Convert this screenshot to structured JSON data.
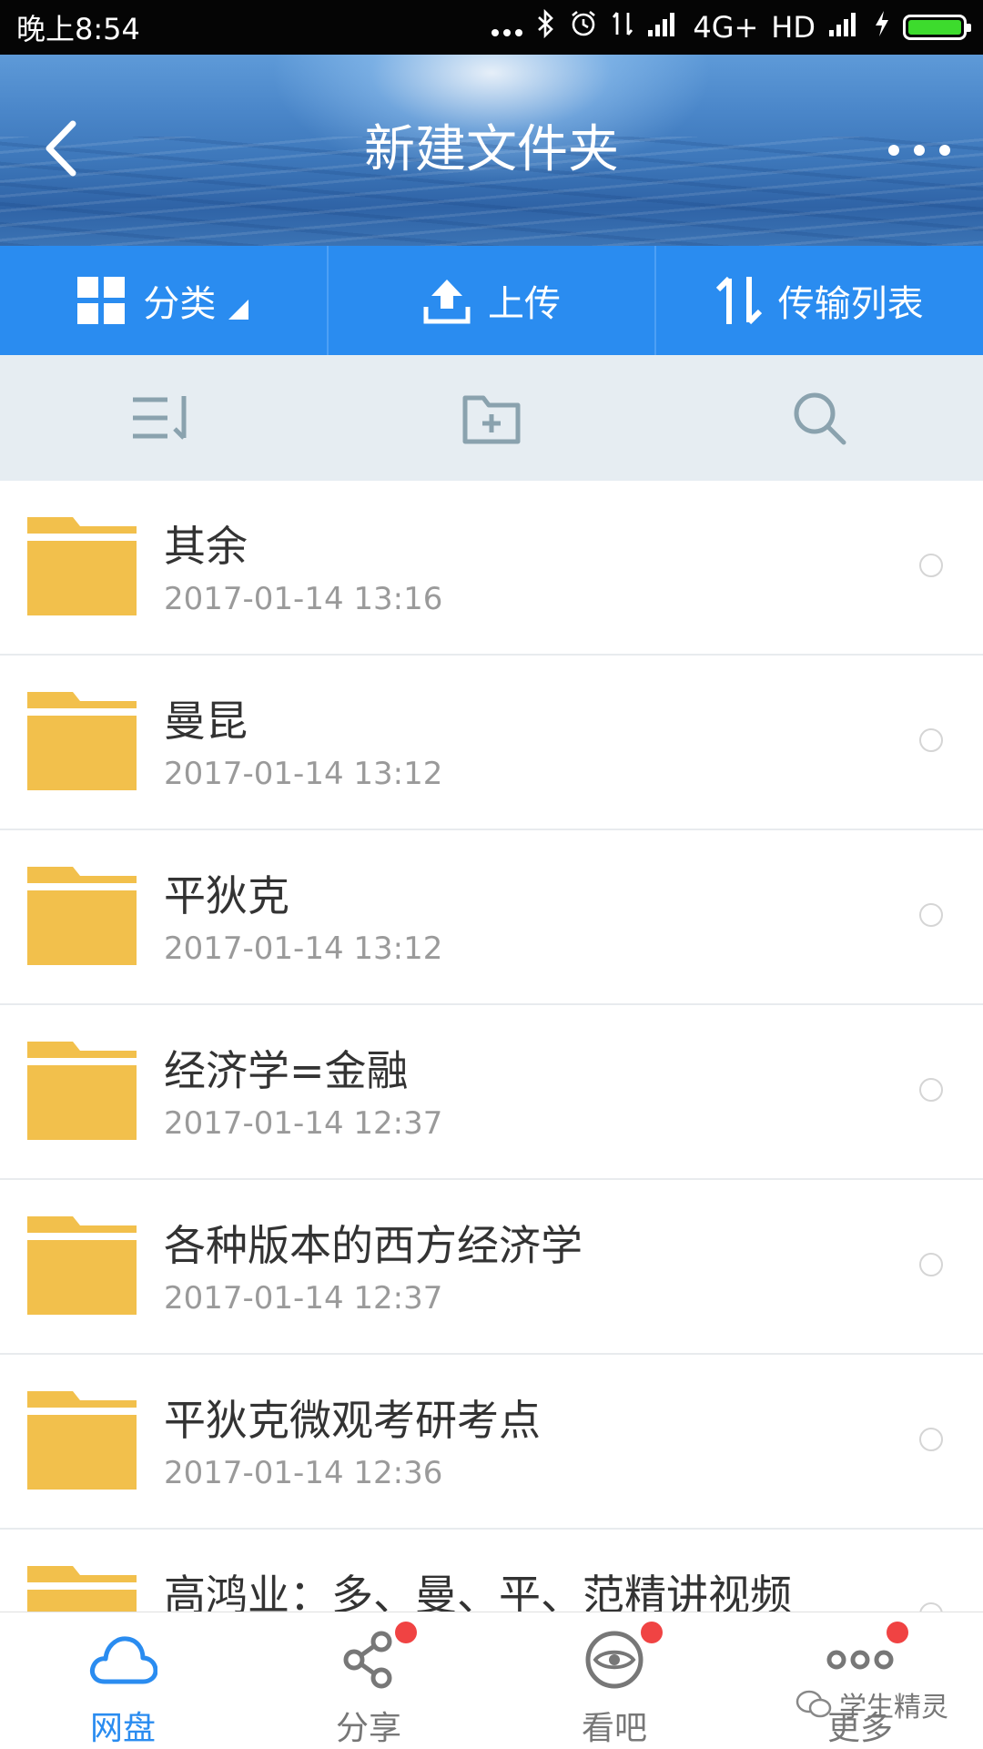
{
  "status_bar": {
    "time": "晚上8:54",
    "network": "4G+",
    "hd": "HD"
  },
  "header": {
    "title": "新建文件夹"
  },
  "action_bar": {
    "category": "分类",
    "upload": "上传",
    "transfer": "传输列表"
  },
  "files": [
    {
      "name": "其余",
      "date": "2017-01-14  13:16"
    },
    {
      "name": "曼昆",
      "date": "2017-01-14  13:12"
    },
    {
      "name": "平狄克",
      "date": "2017-01-14  13:12"
    },
    {
      "name": "经济学=金融",
      "date": "2017-01-14  12:37"
    },
    {
      "name": "各种版本的西方经济学",
      "date": "2017-01-14  12:37"
    },
    {
      "name": "平狄克微观考研考点",
      "date": "2017-01-14  12:36"
    },
    {
      "name": "高鸿业：多、曼、平、范精讲视频",
      "date": ""
    }
  ],
  "bottom_nav": [
    {
      "label": "网盘",
      "icon": "cloud-icon",
      "active": true
    },
    {
      "label": "分享",
      "icon": "share-icon",
      "badge": true
    },
    {
      "label": "看吧",
      "icon": "eye-icon",
      "badge": true
    },
    {
      "label": "更多",
      "icon": "more-icon",
      "badge": true
    }
  ],
  "watermark": "学生精灵",
  "colors": {
    "primary": "#2a8cf0",
    "folder": "#f2c04c",
    "badge": "#f04343"
  }
}
